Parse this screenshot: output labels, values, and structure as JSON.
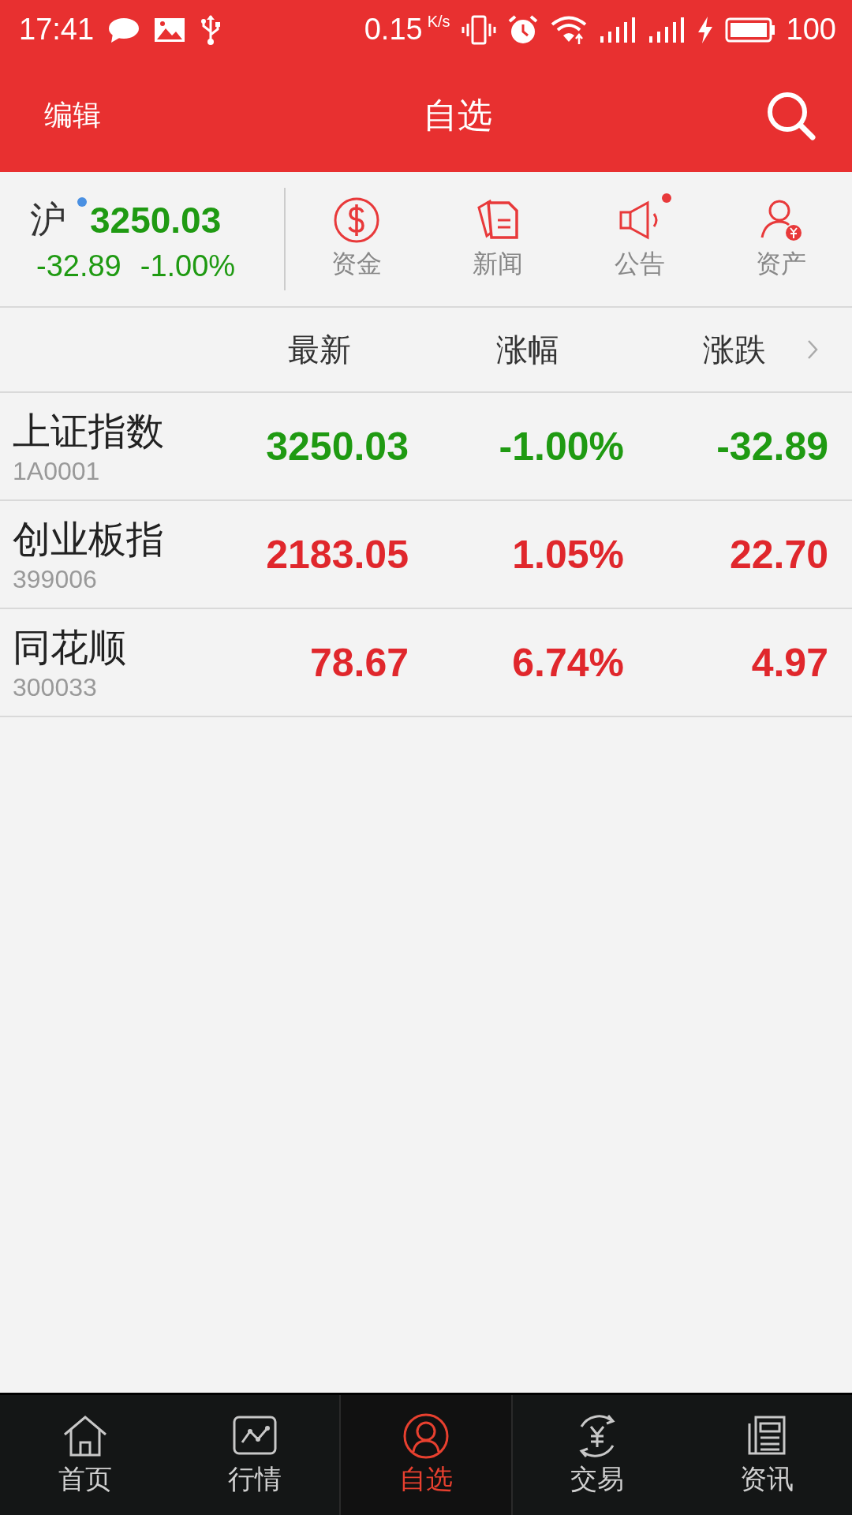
{
  "status_bar": {
    "time": "17:41",
    "speed": "0.15",
    "speed_unit": "K/s",
    "battery": "100"
  },
  "header": {
    "edit": "编辑",
    "title": "自选"
  },
  "index": {
    "name": "沪",
    "badge": true,
    "value": "3250.03",
    "change": "-32.89",
    "percent": "-1.00%",
    "color": "#1f9a12"
  },
  "shortcuts": [
    {
      "label": "资金",
      "badge": false
    },
    {
      "label": "新闻",
      "badge": false
    },
    {
      "label": "公告",
      "badge": true
    },
    {
      "label": "资产",
      "badge": false
    }
  ],
  "table": {
    "columns": [
      "最新",
      "涨幅",
      "涨跌"
    ],
    "rows": [
      {
        "name": "上证指数",
        "code": "1A0001",
        "price": "3250.03",
        "percent": "-1.00%",
        "change": "-32.89",
        "color": "#1f9a12"
      },
      {
        "name": "创业板指",
        "code": "399006",
        "price": "2183.05",
        "percent": "1.05%",
        "change": "22.70",
        "color": "#e0272c"
      },
      {
        "name": "同花顺",
        "code": "300033",
        "price": "78.67",
        "percent": "6.74%",
        "change": "4.97",
        "color": "#e0272c"
      }
    ]
  },
  "bottom_nav": [
    {
      "label": "首页",
      "selected": false
    },
    {
      "label": "行情",
      "selected": false
    },
    {
      "label": "自选",
      "selected": true
    },
    {
      "label": "交易",
      "selected": false
    },
    {
      "label": "资讯",
      "selected": false
    }
  ]
}
